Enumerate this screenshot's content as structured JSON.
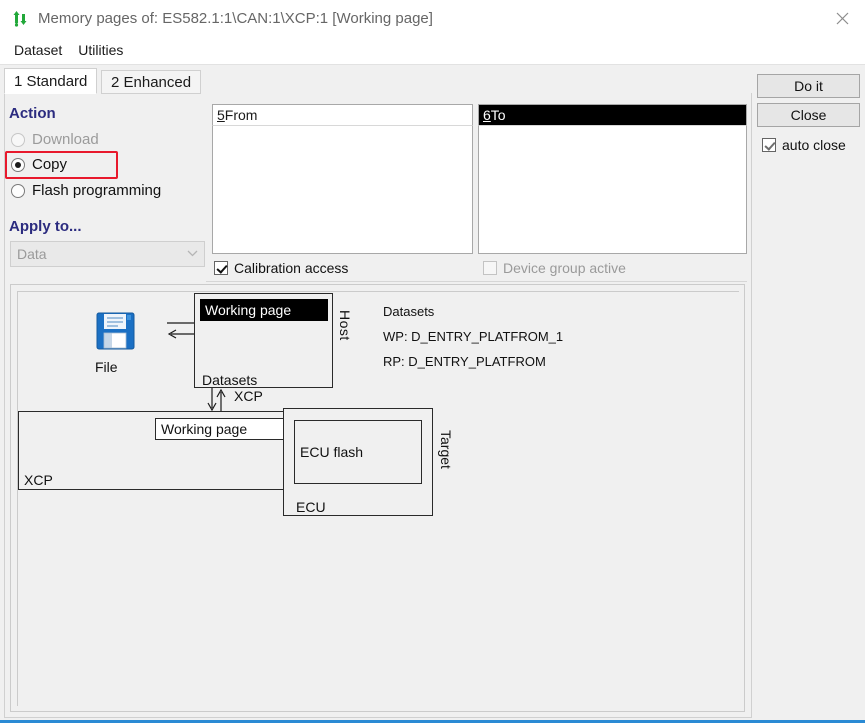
{
  "window": {
    "title": "Memory pages of: ES582.1:1\\CAN:1\\XCP:1 [Working page]",
    "icon": "memory-pages-icon",
    "close_label": "✕"
  },
  "menubar": {
    "items": [
      {
        "label": "Dataset"
      },
      {
        "label": "Utilities"
      }
    ]
  },
  "tabs": [
    {
      "label": "1 Standard",
      "active": true
    },
    {
      "label": "2 Enhanced",
      "active": false
    }
  ],
  "action_group": {
    "heading": "Action",
    "options": [
      {
        "label": "Download",
        "selected": false,
        "disabled": true
      },
      {
        "label": "Copy",
        "selected": true,
        "disabled": false,
        "highlighted": true
      },
      {
        "label": "Flash programming",
        "selected": false,
        "disabled": false
      }
    ]
  },
  "apply_to": {
    "heading": "Apply to...",
    "value": "Data",
    "disabled": true,
    "arrow": "⌄"
  },
  "from_panel": {
    "accesskey": "5",
    "label": " From",
    "items": []
  },
  "to_panel": {
    "accesskey": "6",
    "label": " To",
    "items": [],
    "selected": true
  },
  "checkboxes": {
    "calibration_access": {
      "label": "Calibration access",
      "checked": true,
      "disabled": false
    },
    "device_group_active": {
      "label": "Device group active",
      "checked": false,
      "disabled": true
    },
    "auto_close": {
      "label": "auto close",
      "checked": true,
      "disabled": false
    }
  },
  "buttons": {
    "do_it": "Do it",
    "close": "Close"
  },
  "diagram": {
    "file_label": "File",
    "host_label": "Host",
    "target_label": "Target",
    "host_working_page": "Working page",
    "host_datasets": "Datasets",
    "xcp_arrow_label": "XCP",
    "xcp_box_label": "XCP",
    "xcp_working_page": "Working page",
    "ecu_label": "ECU",
    "ecu_flash_label": "ECU flash",
    "info": {
      "title": "Datasets",
      "wp": "WP: D_ENTRY_PLATFROM_1",
      "rp": "RP: D_ENTRY_PLATFROM"
    }
  },
  "colors": {
    "heading": "#2b2b7f",
    "highlight": "#e8192c",
    "accent_bottom": "#2a8ad4",
    "selected_bg": "#000000"
  }
}
